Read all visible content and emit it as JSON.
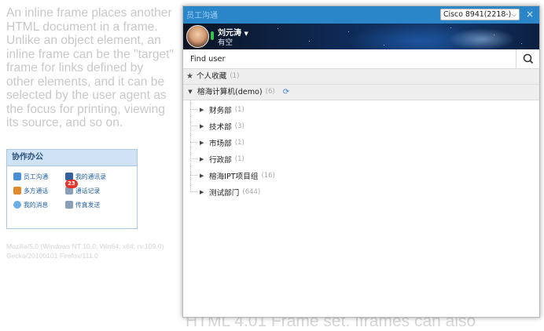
{
  "background_page": {
    "paragraph": "An inline frame places another HTML document in a frame. Unlike an object element, an inline frame can be the \"target\" frame for links defined by other elements, and it can be selected by the user agent as the focus for printing, viewing its source, and so on.",
    "user_agent": "Mozilla/5.0 (Windows NT 10.0; Win64; x64; rv:109.0) Gecko/20100101 Firefox/111.0",
    "bottom_text": "HTML 4.01 Frame set. Iframes can also",
    "office_widget": {
      "title": "协作办公",
      "items": [
        {
          "label": "员工沟通",
          "icon": "people-icon"
        },
        {
          "label": "我的通讯录",
          "icon": "address-book-icon"
        },
        {
          "label": "多方通话",
          "icon": "group-call-icon"
        },
        {
          "label": "通话记录",
          "icon": "call-log-icon",
          "badge": "23"
        },
        {
          "label": "我的消息",
          "icon": "message-icon"
        },
        {
          "label": "传真发送",
          "icon": "fax-icon"
        }
      ]
    }
  },
  "window": {
    "title": "员工沟通",
    "device_select": "Cisco 8941(2218-)",
    "close_label": "×",
    "user": {
      "name": "刘元涛",
      "status": "有空",
      "status_color": "#39c24a"
    },
    "search": {
      "placeholder": "Find user",
      "value": ""
    },
    "favorites": {
      "label": "个人收藏",
      "count": "(1)"
    },
    "org": {
      "label": "榕海计算机(demo)",
      "count": "(6)",
      "departments": [
        {
          "name": "财务部",
          "count": "(1)"
        },
        {
          "name": "技术部",
          "count": "(3)"
        },
        {
          "name": "市场部",
          "count": "(1)"
        },
        {
          "name": "行政部",
          "count": "(1)"
        },
        {
          "name": "榕海IPT项目组",
          "count": "(16)"
        },
        {
          "name": "测试部门",
          "count": "(644)"
        }
      ]
    },
    "accent_color": "#2b86c9"
  }
}
